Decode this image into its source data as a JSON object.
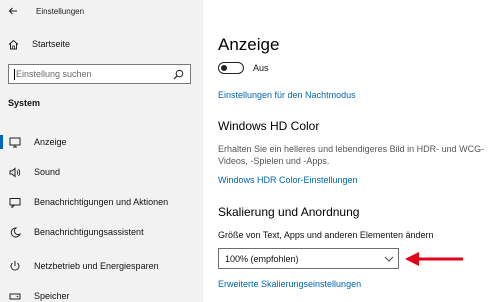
{
  "window": {
    "title": "Einstellungen"
  },
  "sidebar": {
    "home_label": "Startseite",
    "search_placeholder": "Einstellung suchen",
    "section_label": "System",
    "items": [
      {
        "label": "Anzeige",
        "icon": "display-icon",
        "active": true
      },
      {
        "label": "Sound",
        "icon": "speaker-icon",
        "active": false
      },
      {
        "label": "Benachrichtigungen und Aktionen",
        "icon": "message-icon",
        "active": false
      },
      {
        "label": "Benachrichtigungsassistent",
        "icon": "moon-icon",
        "active": false
      },
      {
        "label": "Netzbetrieb und Energiesparen",
        "icon": "power-icon",
        "active": false
      },
      {
        "label": "Speicher",
        "icon": "drive-icon",
        "active": false
      }
    ]
  },
  "main": {
    "title": "Anzeige",
    "toggle_label": "Aus",
    "toggle_on": false,
    "night_mode_link": "Einstellungen für den Nachtmodus",
    "hd_color": {
      "heading": "Windows HD Color",
      "description_line1": "Erhalten Sie ein helleres und lebendigeres Bild in HDR- und WCG-",
      "description_line2": "Videos, -Spielen und -Apps.",
      "link": "Windows HDR Color-Einstellungen"
    },
    "scaling": {
      "heading": "Skalierung und Anordnung",
      "field_label": "Größe von Text, Apps und anderen Elementen ändern",
      "selected_value": "100% (empfohlen)",
      "advanced_link": "Erweiterte Skalierungseinstellungen"
    }
  },
  "colors": {
    "accent": "#0067c0",
    "link": "#0066b4",
    "annotation_arrow": "#e3001b",
    "sidebar_bg": "#f2f2f2"
  }
}
